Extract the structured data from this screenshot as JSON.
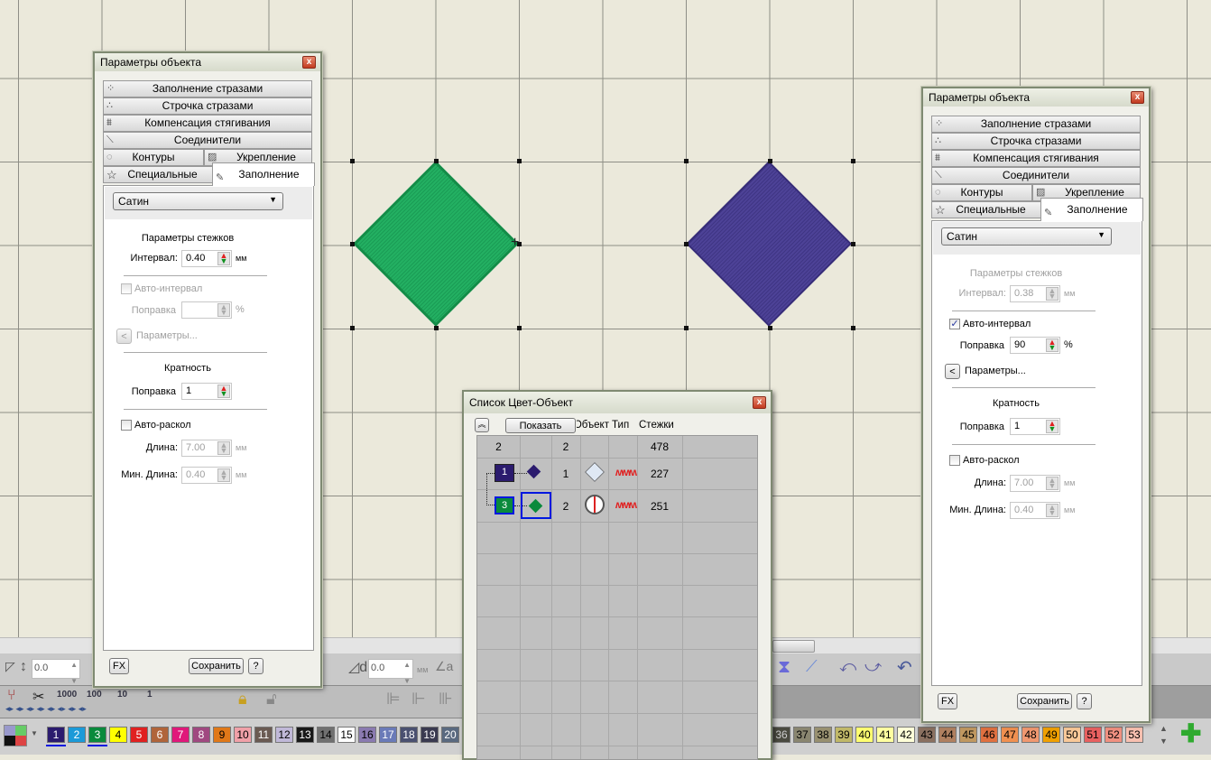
{
  "canvas": {
    "objects": [
      {
        "name": "green-satin-diamond",
        "color": "#1fae5c"
      },
      {
        "name": "purple-satin-diamond",
        "color": "#4b3f93"
      }
    ]
  },
  "toolbar": {
    "spin_left_value": "0.0",
    "spin_mid_value": "0.0",
    "spin_mid_unit": "мм",
    "step_labels": [
      "1000",
      "100",
      "10",
      "1"
    ]
  },
  "palette": {
    "selected": [
      "1",
      "3"
    ],
    "swatches": [
      {
        "n": "1",
        "c": "#2b1b6e",
        "t": "#fff"
      },
      {
        "n": "2",
        "c": "#1b9ad8",
        "t": "#fff"
      },
      {
        "n": "3",
        "c": "#0a8a3c",
        "t": "#fff"
      },
      {
        "n": "4",
        "c": "#ffff00",
        "t": "#000"
      },
      {
        "n": "5",
        "c": "#e02020",
        "t": "#fff"
      },
      {
        "n": "6",
        "c": "#b0643a",
        "t": "#fff"
      },
      {
        "n": "7",
        "c": "#e0187a",
        "t": "#fff"
      },
      {
        "n": "8",
        "c": "#a04880",
        "t": "#fff"
      },
      {
        "n": "9",
        "c": "#e07818",
        "t": "#000"
      },
      {
        "n": "10",
        "c": "#f0a0a8",
        "t": "#000"
      },
      {
        "n": "11",
        "c": "#6a5a52",
        "t": "#fff"
      },
      {
        "n": "12",
        "c": "#c0b8d8",
        "t": "#000"
      },
      {
        "n": "13",
        "c": "#181818",
        "t": "#fff"
      },
      {
        "n": "14",
        "c": "#707070",
        "t": "#000"
      },
      {
        "n": "15",
        "c": "#ffffff",
        "t": "#000"
      },
      {
        "n": "16",
        "c": "#8a7ab0",
        "t": "#000"
      },
      {
        "n": "17",
        "c": "#6a7ab8",
        "t": "#fff"
      },
      {
        "n": "18",
        "c": "#4a5070",
        "t": "#fff"
      },
      {
        "n": "19",
        "c": "#3a3a50",
        "t": "#fff"
      },
      {
        "n": "20",
        "c": "#5a6a80",
        "t": "#fff"
      }
    ],
    "swatches_right": [
      {
        "n": "36",
        "c": "#4a4a40",
        "t": "#ccc"
      },
      {
        "n": "37",
        "c": "#8a8670",
        "t": "#000"
      },
      {
        "n": "38",
        "c": "#989070",
        "t": "#000"
      },
      {
        "n": "39",
        "c": "#c0b868",
        "t": "#000"
      },
      {
        "n": "40",
        "c": "#ffff70",
        "t": "#000"
      },
      {
        "n": "41",
        "c": "#ffffa0",
        "t": "#000"
      },
      {
        "n": "42",
        "c": "#ffffd8",
        "t": "#000"
      },
      {
        "n": "43",
        "c": "#8a7060",
        "t": "#000"
      },
      {
        "n": "44",
        "c": "#b08060",
        "t": "#000"
      },
      {
        "n": "45",
        "c": "#c09860",
        "t": "#000"
      },
      {
        "n": "46",
        "c": "#e07040",
        "t": "#000"
      },
      {
        "n": "47",
        "c": "#f09050",
        "t": "#000"
      },
      {
        "n": "48",
        "c": "#f09870",
        "t": "#000"
      },
      {
        "n": "49",
        "c": "#f0a000",
        "t": "#000"
      },
      {
        "n": "50",
        "c": "#f8c898",
        "t": "#000"
      },
      {
        "n": "51",
        "c": "#e86060",
        "t": "#000"
      },
      {
        "n": "52",
        "c": "#f09080",
        "t": "#000"
      },
      {
        "n": "53",
        "c": "#f8c0b0",
        "t": "#000"
      }
    ]
  },
  "left_panel": {
    "title": "Параметры объекта",
    "tabs": {
      "rhinestone_fill": "Заполнение стразами",
      "rhinestone_line": "Строчка стразами",
      "pull_comp": "Компенсация стягивания",
      "connectors": "Соединители",
      "outlines": "Контуры",
      "underlay": "Укрепление",
      "special": "Специальные",
      "fill": "Заполнение"
    },
    "fill_type": "Сатин",
    "stitch_params": "Параметры стежков",
    "interval_label": "Интервал:",
    "interval_value": "0.40",
    "unit_mm": "мм",
    "auto_interval_label": "Авто-интервал",
    "auto_interval_checked": false,
    "correction_label": "Поправка",
    "correction_value": "",
    "unit_pct": "%",
    "params_button": "<",
    "params_label": "Параметры...",
    "multiplicity": "Кратность",
    "mult_correction_label": "Поправка",
    "mult_correction_value": "1",
    "auto_split_label": "Авто-раскол",
    "auto_split_checked": false,
    "length_label": "Длина:",
    "length_value": "7.00",
    "min_length_label": "Мин. Длина:",
    "min_length_value": "0.40",
    "fx": "FX",
    "save": "Сохранить",
    "help": "?"
  },
  "right_panel": {
    "title": "Параметры объекта",
    "tabs": {
      "rhinestone_fill": "Заполнение стразами",
      "rhinestone_line": "Строчка стразами",
      "pull_comp": "Компенсация стягивания",
      "connectors": "Соединители",
      "outlines": "Контуры",
      "underlay": "Укрепление",
      "special": "Специальные",
      "fill": "Заполнение"
    },
    "fill_type": "Сатин",
    "stitch_params": "Параметры стежков",
    "interval_label": "Интервал:",
    "interval_value": "0.38",
    "unit_mm": "мм",
    "auto_interval_label": "Авто-интервал",
    "auto_interval_checked": true,
    "correction_label": "Поправка",
    "correction_value": "90",
    "unit_pct": "%",
    "params_button": "<",
    "params_label": "Параметры...",
    "multiplicity": "Кратность",
    "mult_correction_label": "Поправка",
    "mult_correction_value": "1",
    "auto_split_label": "Авто-раскол",
    "auto_split_checked": false,
    "length_label": "Длина:",
    "length_value": "7.00",
    "min_length_label": "Мин. Длина:",
    "min_length_value": "0.40",
    "fx": "FX",
    "save": "Сохранить",
    "help": "?"
  },
  "color_list": {
    "title": "Список Цвет-Объект",
    "show_button": "Показать",
    "headers": {
      "object": "Объект",
      "type": "Тип",
      "stitches": "Стежки"
    },
    "summary": {
      "colors": "2",
      "objects": "2",
      "stitches": "478"
    },
    "rows": [
      {
        "color_num": "1",
        "color": "#2b1b6e",
        "object_num": "1",
        "object_color": "#2b1b6e",
        "stitches": "227",
        "selected": false
      },
      {
        "color_num": "3",
        "color": "#0a8a3c",
        "object_num": "2",
        "object_color": "#0a8a3c",
        "stitches": "251",
        "selected": true
      }
    ]
  }
}
